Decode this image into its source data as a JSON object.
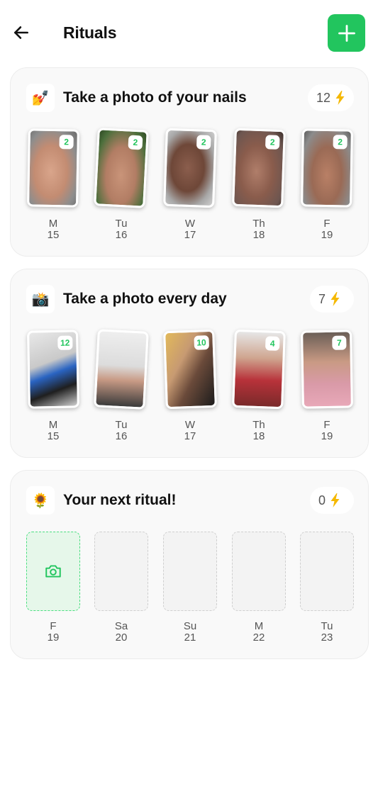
{
  "header": {
    "title": "Rituals",
    "back_icon": "arrow-left-icon",
    "add_icon": "plus-icon"
  },
  "colors": {
    "accent": "#22c55e",
    "card_bg": "#f9f9f9",
    "slot_active_bg": "#e6f7ea"
  },
  "rituals": [
    {
      "emoji": "💅",
      "title": "Take a photo of your nails",
      "streak": "12",
      "streak_icon": "lightning-bolt-icon",
      "days": [
        {
          "day": "M",
          "date": "15",
          "count": "2"
        },
        {
          "day": "Tu",
          "date": "16",
          "count": "2"
        },
        {
          "day": "W",
          "date": "17",
          "count": "2"
        },
        {
          "day": "Th",
          "date": "18",
          "count": "2"
        },
        {
          "day": "F",
          "date": "19",
          "count": "2"
        }
      ]
    },
    {
      "emoji": "📸",
      "title": "Take a photo every day",
      "streak": "7",
      "streak_icon": "lightning-bolt-icon",
      "days": [
        {
          "day": "M",
          "date": "15",
          "count": "12"
        },
        {
          "day": "Tu",
          "date": "16",
          "count": ""
        },
        {
          "day": "W",
          "date": "17",
          "count": "10"
        },
        {
          "day": "Th",
          "date": "18",
          "count": "4"
        },
        {
          "day": "F",
          "date": "19",
          "count": "7"
        }
      ]
    },
    {
      "emoji": "🌻",
      "title": "Your next ritual!",
      "streak": "0",
      "streak_icon": "lightning-bolt-icon",
      "camera_icon": "camera-icon",
      "days": [
        {
          "day": "F",
          "date": "19"
        },
        {
          "day": "Sa",
          "date": "20"
        },
        {
          "day": "Su",
          "date": "21"
        },
        {
          "day": "M",
          "date": "22"
        },
        {
          "day": "Tu",
          "date": "23"
        }
      ]
    }
  ]
}
